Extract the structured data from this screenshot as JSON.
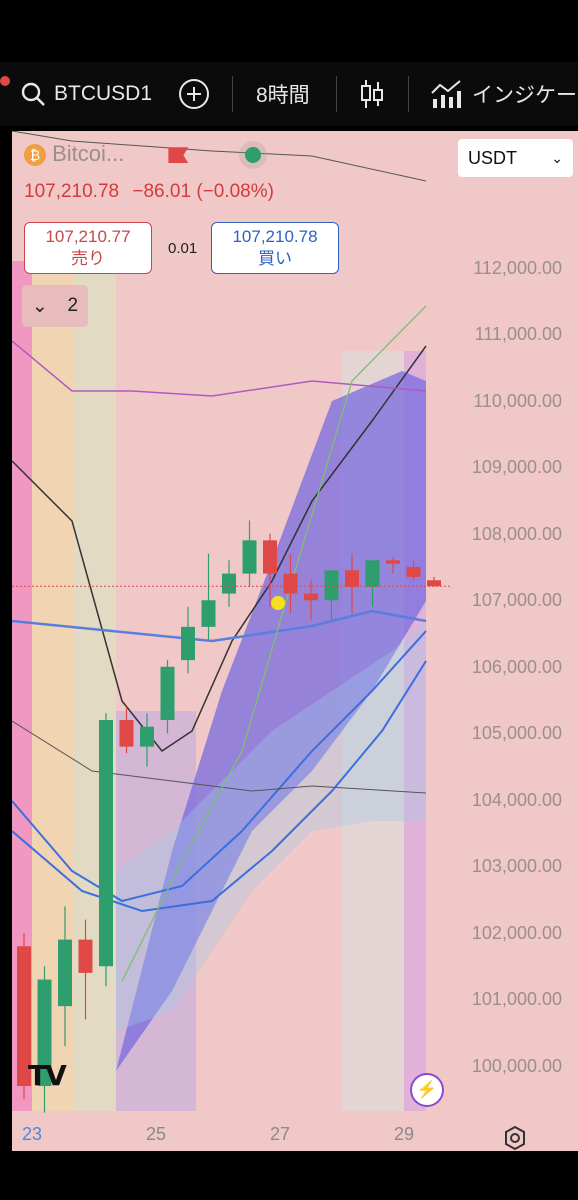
{
  "toolbar": {
    "symbol": "BTCUSD1",
    "interval": "8時間",
    "indicators_label": "インジケー",
    "icons": [
      "search-icon",
      "add-icon",
      "candle-chart-icon",
      "indicators-icon"
    ]
  },
  "legend": {
    "name": "Bitcoi...",
    "last_price": "107,210.78",
    "change": "−86.01",
    "change_pct": "(−0.08%)",
    "sell_price": "107,210.77",
    "sell_label": "売り",
    "spread": "0.01",
    "buy_price": "107,210.78",
    "buy_label": "買い",
    "collapsed_count": "2",
    "currency": "USDT"
  },
  "colors": {
    "up": "#2f9e6e",
    "down": "#e04848",
    "price_line": "#e04848"
  },
  "chart_data": {
    "type": "candlestick",
    "y_ticks": [
      "112,000.00",
      "111,000.00",
      "110,000.00",
      "109,000.00",
      "108,000.00",
      "107,000.00",
      "106,000.00",
      "105,000.00",
      "104,000.00",
      "103,000.00",
      "102,000.00",
      "101,000.00",
      "100,000.00"
    ],
    "x_ticks": [
      "23",
      "25",
      "27",
      "29"
    ],
    "ylim": [
      99700,
      113300
    ],
    "current_price": 107210.78,
    "candles": [
      {
        "o": 101800,
        "h": 102000,
        "l": 99500,
        "c": 99700
      },
      {
        "o": 99700,
        "h": 101500,
        "l": 99300,
        "c": 101300
      },
      {
        "o": 100900,
        "h": 102400,
        "l": 100300,
        "c": 101900
      },
      {
        "o": 101900,
        "h": 102200,
        "l": 100700,
        "c": 101400
      },
      {
        "o": 101500,
        "h": 105300,
        "l": 101200,
        "c": 105200
      },
      {
        "o": 105200,
        "h": 105400,
        "l": 104700,
        "c": 104800
      },
      {
        "o": 104800,
        "h": 105300,
        "l": 104500,
        "c": 105100
      },
      {
        "o": 105200,
        "h": 106100,
        "l": 105000,
        "c": 106000
      },
      {
        "o": 106100,
        "h": 106900,
        "l": 105900,
        "c": 106600
      },
      {
        "o": 106600,
        "h": 107700,
        "l": 106400,
        "c": 107000
      },
      {
        "o": 107100,
        "h": 107600,
        "l": 106900,
        "c": 107400
      },
      {
        "o": 107400,
        "h": 108200,
        "l": 107200,
        "c": 107900
      },
      {
        "o": 107900,
        "h": 108000,
        "l": 106900,
        "c": 107400
      },
      {
        "o": 107400,
        "h": 107700,
        "l": 106800,
        "c": 107100
      },
      {
        "o": 107100,
        "h": 107300,
        "l": 106700,
        "c": 107000
      },
      {
        "o": 107000,
        "h": 107400,
        "l": 106700,
        "c": 107450
      },
      {
        "o": 107450,
        "h": 107700,
        "l": 106800,
        "c": 107200
      },
      {
        "o": 107200,
        "h": 107550,
        "l": 106900,
        "c": 107600
      },
      {
        "o": 107600,
        "h": 107650,
        "l": 107400,
        "c": 107550
      },
      {
        "o": 107500,
        "h": 107600,
        "l": 107300,
        "c": 107350
      },
      {
        "o": 107300,
        "h": 107350,
        "l": 107200,
        "c": 107210
      }
    ]
  }
}
